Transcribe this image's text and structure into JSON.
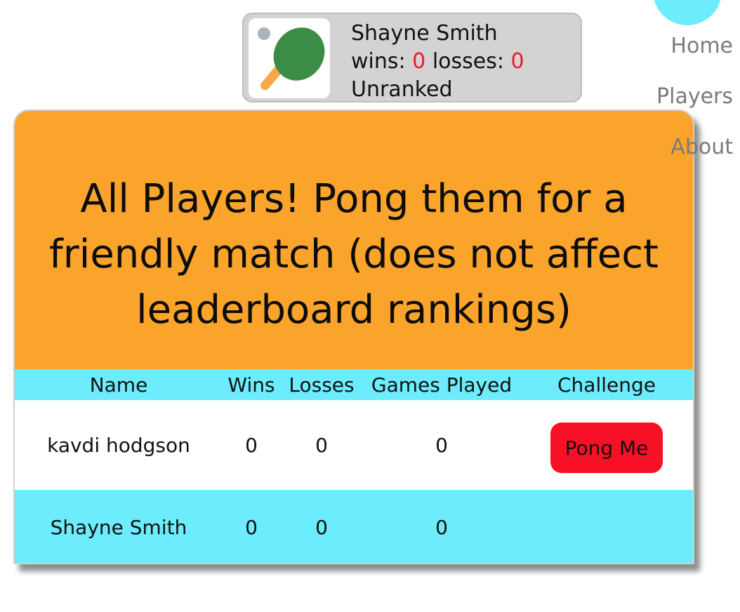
{
  "user": {
    "name": "Shayne Smith",
    "wins_label": "wins:",
    "wins": "0",
    "losses_label": "losses:",
    "losses": "0",
    "rank": "Unranked",
    "avatar_icon": "ping-pong-paddle-icon"
  },
  "nav": {
    "home": "Home",
    "players": "Players",
    "about": "About"
  },
  "page": {
    "title": "All Players! Pong them for a friendly match (does not affect leaderboard rankings)"
  },
  "table": {
    "headers": [
      "Name",
      "Wins",
      "Losses",
      "Games Played",
      "Challenge"
    ],
    "rows": [
      {
        "name": "kavdi hodgson",
        "wins": "0",
        "losses": "0",
        "games_played": "0",
        "challenge": "Pong Me"
      },
      {
        "name": "Shayne Smith",
        "wins": "0",
        "losses": "0",
        "games_played": "0",
        "challenge": ""
      }
    ]
  },
  "colors": {
    "header_background": "#fba42b",
    "table_accent": "#6cecfc",
    "button": "#f81126",
    "stat_numbers": "#f0182b",
    "user_card": "#d3d3d3"
  }
}
